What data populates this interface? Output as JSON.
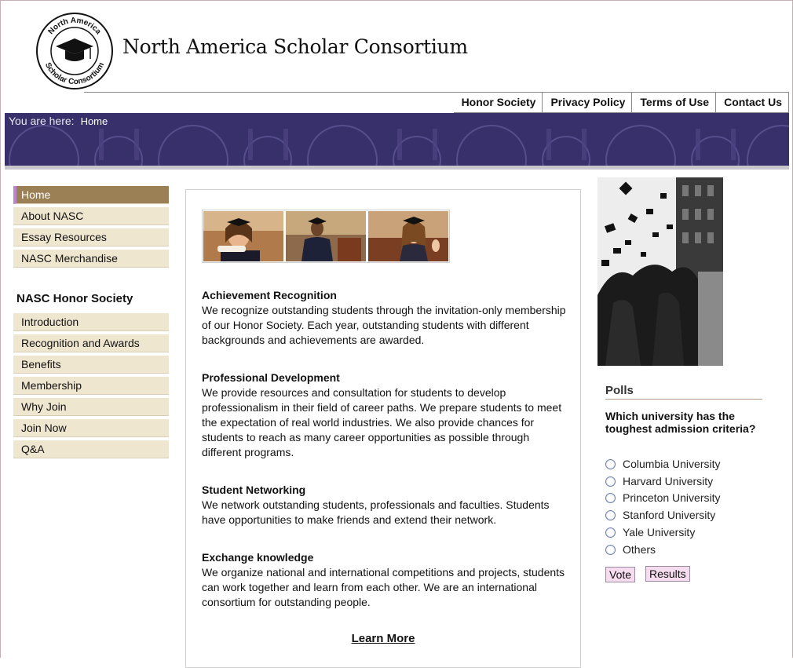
{
  "header": {
    "logo_text_top": "North America",
    "logo_text_bottom": "Scholar Consortium",
    "site_title": "North America Scholar Consortium",
    "nav": [
      "Honor Society",
      "Privacy Policy",
      "Terms of Use",
      "Contact Us"
    ]
  },
  "breadcrumb": {
    "label": "You are here:",
    "current": "Home"
  },
  "left_nav": {
    "main": [
      "Home",
      "About NASC",
      "Essay Resources",
      "NASC Merchandise"
    ],
    "honor_heading": "NASC Honor Society",
    "honor": [
      "Introduction",
      "Recognition and Awards",
      "Benefits",
      "Membership",
      "Why Join",
      "Join Now",
      "Q&A"
    ]
  },
  "main": {
    "sections": [
      {
        "title": "Achievement Recognition",
        "body": "We recognize outstanding students through the invitation-only membership of our Honor Society. Each year, outstanding students with different backgrounds and achievements are awarded."
      },
      {
        "title": "Professional Development",
        "body": "We provide resources and consultation for students to develop professionalism in their field of career paths. We prepare students to meet the expectation of real world industries. We also provide chances for students to reach as many career opportunities as possible through different programs."
      },
      {
        "title": "Student Networking",
        "body": "We network outstanding students, professionals and faculties. Students have opportunities to make friends and extend their network."
      },
      {
        "title": "Exchange knowledge",
        "body": "We organize national and international competitions and projects, students can work together and learn from each other. We are an international consortium for outstanding people."
      }
    ],
    "learn_more": "Learn More"
  },
  "polls": {
    "title": "Polls",
    "question": "Which university has the toughest admission criteria?",
    "options": [
      "Columbia University",
      "Harvard University",
      "Princeton University",
      "Stanford University",
      "Yale University",
      "Others"
    ],
    "vote_label": "Vote",
    "results_label": "Results"
  },
  "colors": {
    "banner": "#38306a",
    "nav_bg": "#efe6d0",
    "nav_active": "#9b7f55",
    "button_bg": "#f6dcef"
  }
}
